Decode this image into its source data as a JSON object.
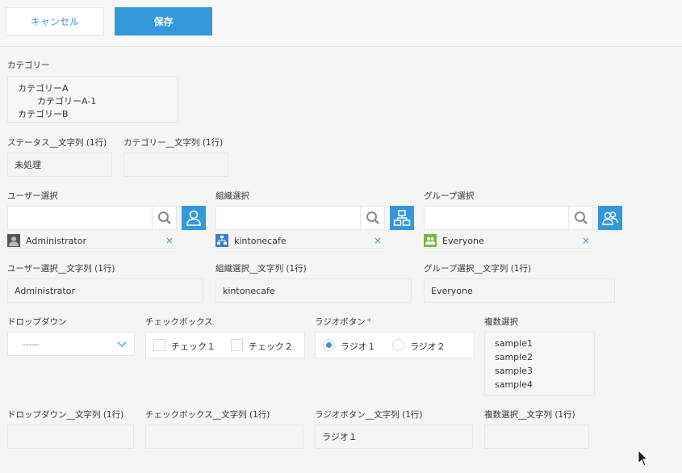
{
  "toolbar": {
    "cancel_label": "キャンセル",
    "save_label": "保存"
  },
  "category": {
    "label": "カテゴリー",
    "items": [
      "カテゴリーA",
      "カテゴリーA-1",
      "カテゴリーB"
    ]
  },
  "status_text": {
    "label": "ステータス__文字列 (1行)",
    "value": "未処理"
  },
  "category_text": {
    "label": "カテゴリー__文字列 (1行)",
    "value": ""
  },
  "user_select": {
    "label": "ユーザー選択",
    "entity": "Administrator",
    "remove": "×"
  },
  "org_select": {
    "label": "組織選択",
    "entity": "kintonecafe",
    "remove": "×"
  },
  "group_select": {
    "label": "グループ選択",
    "entity": "Everyone",
    "remove": "×"
  },
  "user_text": {
    "label": "ユーザー選択__文字列 (1行)",
    "value": "Administrator"
  },
  "org_text": {
    "label": "組織選択__文字列 (1行)",
    "value": "kintonecafe"
  },
  "group_text": {
    "label": "グループ選択__文字列 (1行)",
    "value": "Everyone"
  },
  "dropdown": {
    "label": "ドロップダウン",
    "value": "-----"
  },
  "checkbox": {
    "label": "チェックボックス",
    "options": [
      "チェック１",
      "チェック２"
    ]
  },
  "radio": {
    "label": "ラジオボタン",
    "required": "*",
    "options": [
      "ラジオ１",
      "ラジオ２"
    ],
    "selected": 0
  },
  "multi_select": {
    "label": "複数選択",
    "options": [
      "sample1",
      "sample2",
      "sample3",
      "sample4"
    ]
  },
  "dropdown_text": {
    "label": "ドロップダウン__文字列 (1行)",
    "value": ""
  },
  "checkbox_text": {
    "label": "チェックボックス__文字列 (1行)",
    "value": ""
  },
  "radio_text": {
    "label": "ラジオボタン__文字列 (1行)",
    "value": "ラジオ１"
  },
  "multi_text": {
    "label": "複数選択__文字列 (1行)",
    "value": ""
  },
  "icons": {
    "search": "search-icon",
    "user": "user-icon",
    "org": "org-chart-icon",
    "group": "group-icon",
    "remove": "close-icon",
    "chevron": "chevron-down-icon",
    "cursor": "mouse-cursor-icon"
  },
  "colors": {
    "accent": "#3498db",
    "border": "#e3e7e8",
    "background": "#f5f5f5",
    "required": "#e74c3c"
  }
}
